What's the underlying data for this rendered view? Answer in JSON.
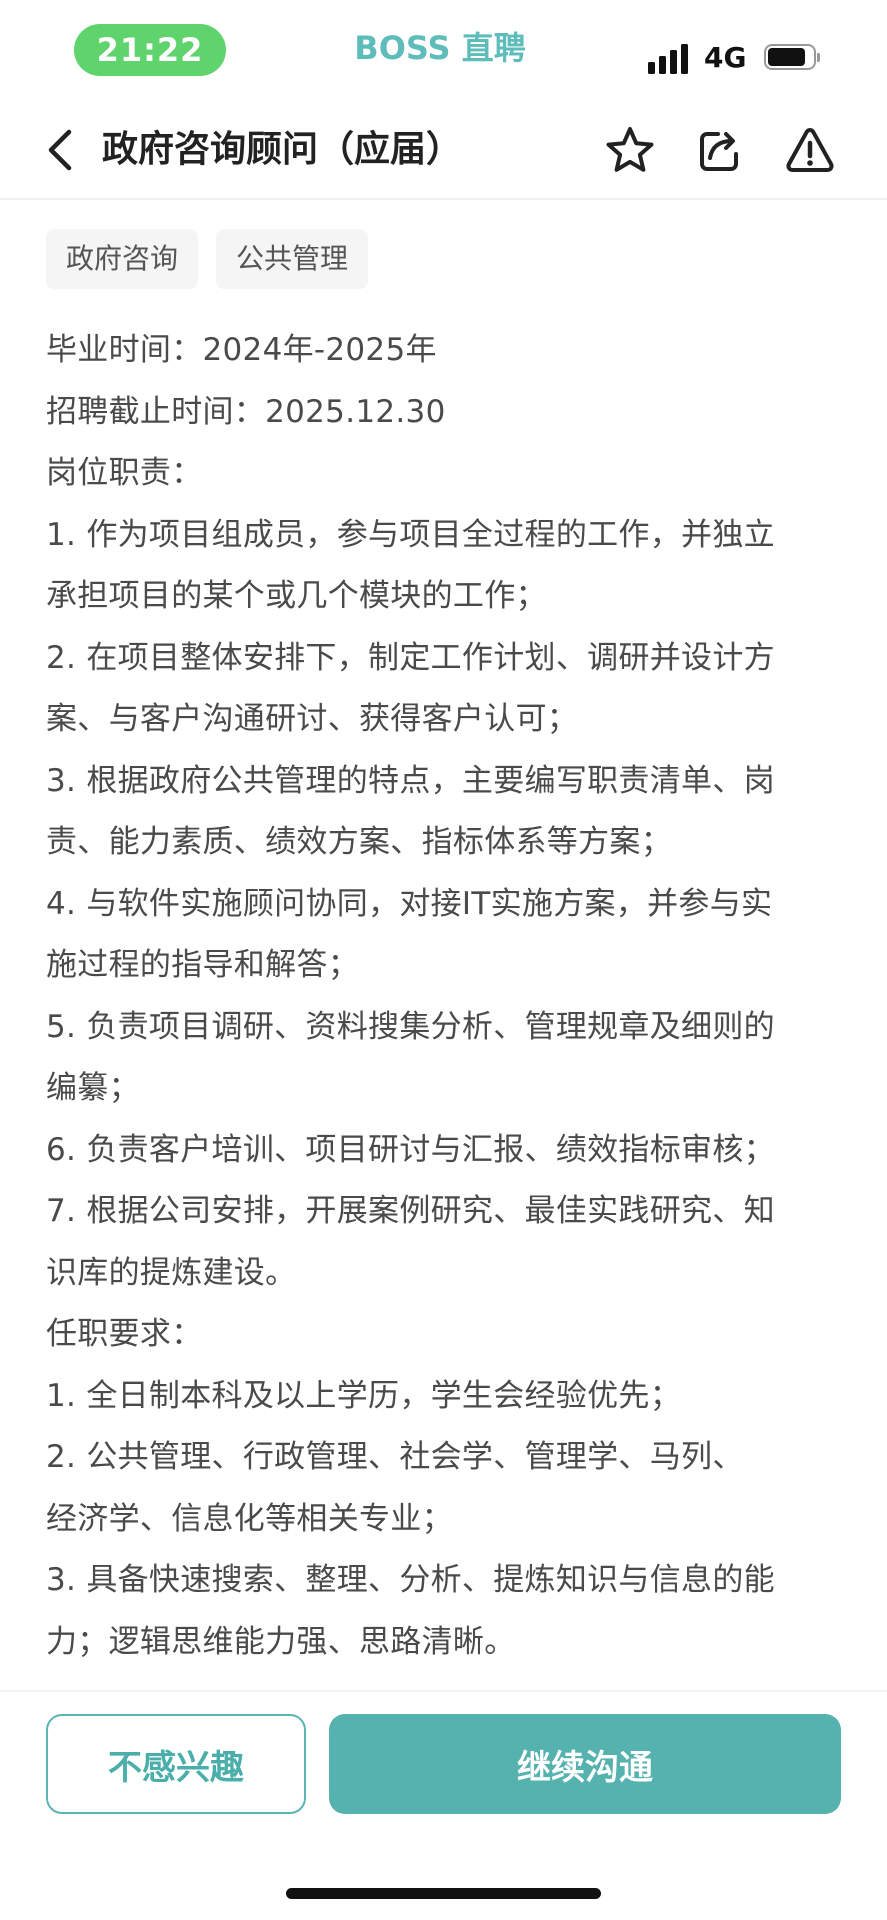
{
  "status_bar": {
    "time": "21:22",
    "app_name": "BOSS 直聘",
    "network": "4G",
    "battery_level": 0.85,
    "time_pill_color": "#5fd36c"
  },
  "nav": {
    "title": "政府咨询顾问（应届）",
    "icons": [
      "back-arrow-icon",
      "star-icon",
      "share-icon",
      "warning-icon"
    ]
  },
  "tags": [
    "政府咨询",
    "公共管理"
  ],
  "description_lines": [
    "毕业时间：2024年-2025年",
    "招聘截止时间：2025.12.30",
    "岗位职责：",
    "1. 作为项目组成员，参与项目全过程的工作，并独立",
    "承担项目的某个或几个模块的工作；",
    "2. 在项目整体安排下，制定工作计划、调研并设计方",
    "案、与客户沟通研讨、获得客户认可；",
    "3. 根据政府公共管理的特点，主要编写职责清单、岗",
    "责、能力素质、绩效方案、指标体系等方案；",
    "4. 与软件实施顾问协同，对接IT实施方案，并参与实",
    "施过程的指导和解答；",
    "5. 负责项目调研、资料搜集分析、管理规章及细则的",
    "编纂；",
    "6. 负责客户培训、项目研讨与汇报、绩效指标审核；",
    "7. 根据公司安排，开展案例研究、最佳实践研究、知",
    "识库的提炼建设。",
    "任职要求：",
    "1.  全日制本科及以上学历，学生会经验优先；",
    "2.  公共管理、行政管理、社会学、管理学、马列、",
    "经济学、信息化等相关专业；",
    "3. 具备快速搜索、整理、分析、提炼知识与信息的能",
    "力；逻辑思维能力强、思路清晰。"
  ],
  "actions": {
    "not_interested": "不感兴趣",
    "continue_chat": "继续沟通"
  },
  "colors": {
    "accent": "#55b2ae",
    "brand_text": "#5ebdbb"
  }
}
